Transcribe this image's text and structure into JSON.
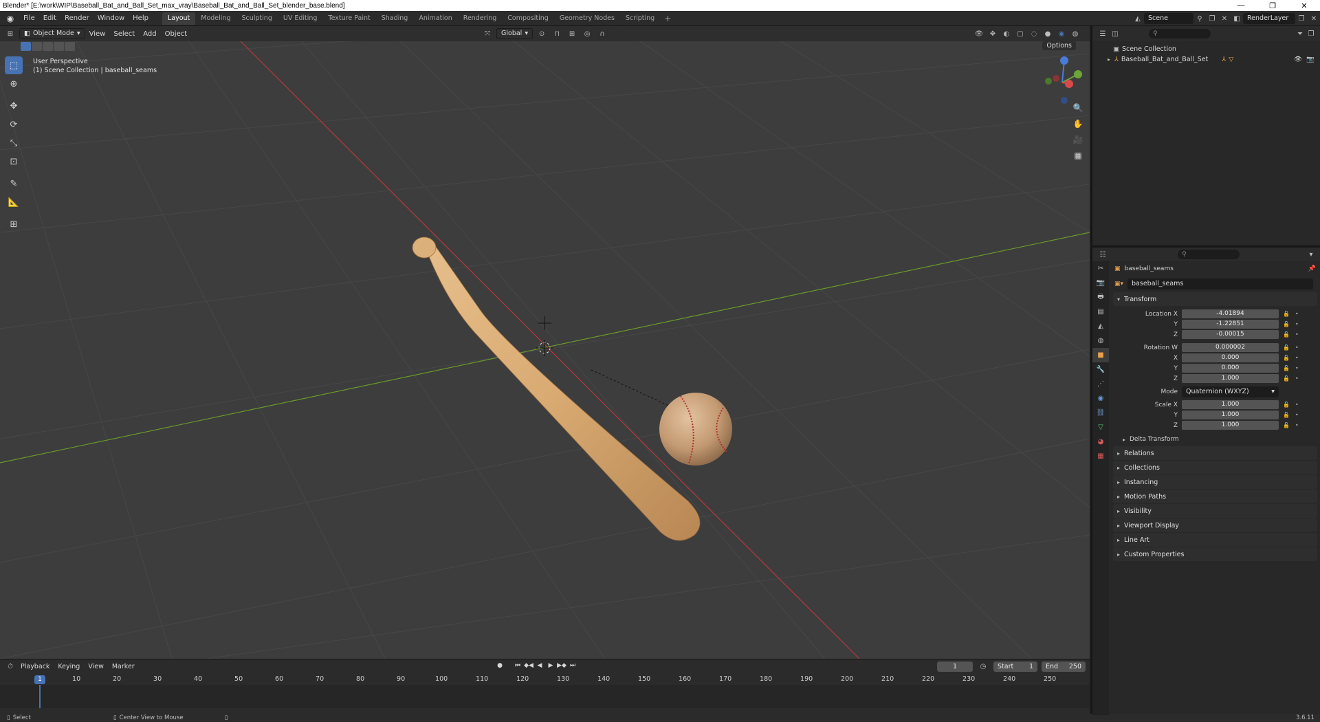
{
  "window": {
    "title": "Blender* [E:\\work\\WIP\\Baseball_Bat_and_Ball_Set_max_vray\\Baseball_Bat_and_Ball_Set_blender_base.blend]",
    "minimize": "—",
    "maximize": "❐",
    "close": "✕"
  },
  "menu": [
    "File",
    "Edit",
    "Render",
    "Window",
    "Help"
  ],
  "workspaces": [
    "Layout",
    "Modeling",
    "Sculpting",
    "UV Editing",
    "Texture Paint",
    "Shading",
    "Animation",
    "Rendering",
    "Compositing",
    "Geometry Nodes",
    "Scripting"
  ],
  "active_workspace": "Layout",
  "scene": "Scene",
  "render_layer": "RenderLayer",
  "viewport": {
    "mode": "Object Mode",
    "menus": [
      "View",
      "Select",
      "Add",
      "Object"
    ],
    "transform_orientation": "Global",
    "options": "Options",
    "perspective": "User Perspective",
    "collection_path": "(1) Scene Collection | baseball_seams"
  },
  "timeline": {
    "menus": [
      "Playback",
      "Keying",
      "View",
      "Marker"
    ],
    "current_frame": "1",
    "start_label": "Start",
    "start": "1",
    "end_label": "End",
    "end": "250",
    "ticks": [
      "10",
      "20",
      "30",
      "40",
      "50",
      "60",
      "70",
      "80",
      "90",
      "100",
      "110",
      "120",
      "130",
      "140",
      "150",
      "160",
      "170",
      "180",
      "190",
      "200",
      "210",
      "220",
      "230",
      "240",
      "250"
    ]
  },
  "status": {
    "select": "Select",
    "center_view": "Center View to Mouse",
    "version": "3.6.11"
  },
  "outliner": {
    "root": "Scene Collection",
    "items": [
      "Baseball_Bat_and_Ball_Set"
    ]
  },
  "properties": {
    "object_name": "baseball_seams",
    "data_name": "baseball_seams",
    "transform_title": "Transform",
    "location": {
      "label": "Location X",
      "x": "-4.01894",
      "y": "-1.22851",
      "z": "-0.00015"
    },
    "rotation": {
      "label": "Rotation W",
      "w": "0.000002",
      "x": "0.000",
      "y": "0.000",
      "z": "1.000"
    },
    "mode_label": "Mode",
    "mode": "Quaternion (WXYZ)",
    "scale": {
      "label": "Scale X",
      "x": "1.000",
      "y": "1.000",
      "z": "1.000"
    },
    "axis_labels": {
      "x": "X",
      "y": "Y",
      "z": "Z"
    },
    "delta": "Delta Transform",
    "panels": [
      "Relations",
      "Collections",
      "Instancing",
      "Motion Paths",
      "Visibility",
      "Viewport Display",
      "Line Art",
      "Custom Properties"
    ]
  },
  "colors": {
    "accent": "#4772b3",
    "x_axis": "#c0393b",
    "y_axis": "#6a9a2a",
    "bat_wood": "#d9aa72",
    "ball": "#c8a07a"
  }
}
